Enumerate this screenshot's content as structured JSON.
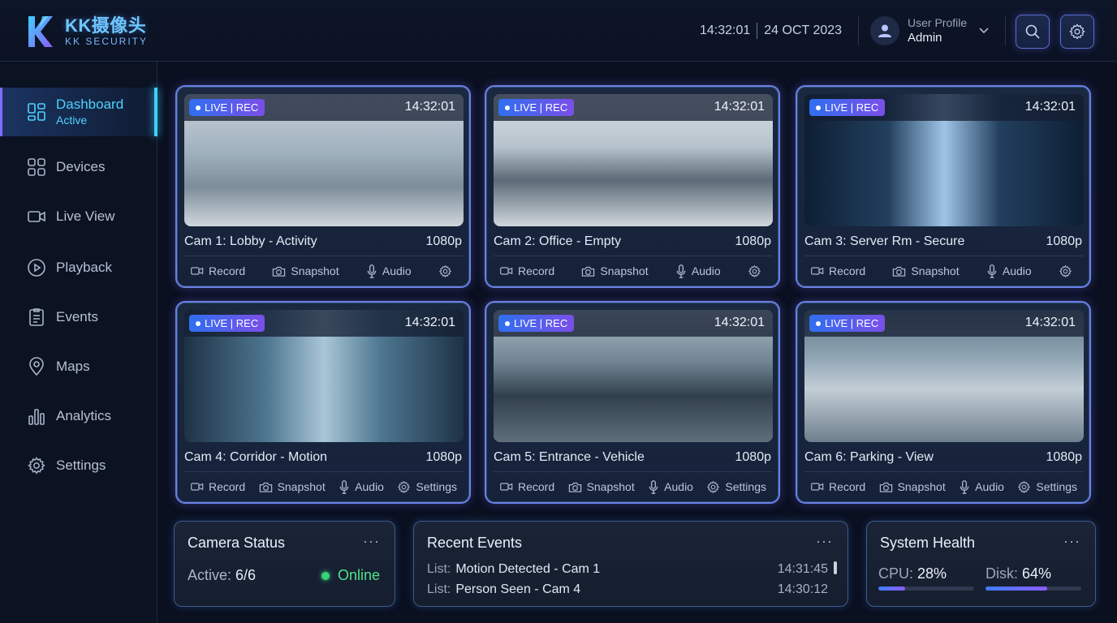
{
  "brand": {
    "title": "KK摄像头",
    "subtitle": "KK SECURITY"
  },
  "header": {
    "time": "14:32:01",
    "date": "24 OCT 2023",
    "profile_label": "User Profile",
    "profile_name": "Admin"
  },
  "sidebar": {
    "items": [
      {
        "label": "Dashboard",
        "sub": "Active",
        "icon": "dashboard-icon"
      },
      {
        "label": "Devices",
        "icon": "grid-icon"
      },
      {
        "label": "Live View",
        "icon": "video-camera-icon"
      },
      {
        "label": "Playback",
        "icon": "play-circle-icon"
      },
      {
        "label": "Events",
        "icon": "clipboard-list-icon"
      },
      {
        "label": "Maps",
        "icon": "map-pin-icon"
      },
      {
        "label": "Analytics",
        "icon": "bar-chart-icon"
      },
      {
        "label": "Settings",
        "icon": "gear-icon"
      }
    ]
  },
  "cameras": [
    {
      "badge": "LIVE | REC",
      "time": "14:32:01",
      "name": "Cam 1: Lobby - Activity",
      "res": "1080p",
      "actions": [
        "Record",
        "Snapshot",
        "Audio"
      ]
    },
    {
      "badge": "LIVE | REC",
      "time": "14:32:01",
      "name": "Cam 2: Office - Empty",
      "res": "1080p",
      "actions": [
        "Record",
        "Snapshot",
        "Audio"
      ]
    },
    {
      "badge": "LIVE | REC",
      "time": "14:32:01",
      "name": "Cam 3: Server Rm - Secure",
      "res": "1080p",
      "actions": [
        "Record",
        "Snapshot",
        "Audio"
      ]
    },
    {
      "badge": "LIVE | REC",
      "time": "14:32:01",
      "name": "Cam 4: Corridor - Motion",
      "res": "1080p",
      "actions": [
        "Record",
        "Snapshot",
        "Audio",
        "Settings"
      ]
    },
    {
      "badge": "LIVE | REC",
      "time": "14:32:01",
      "name": "Cam 5: Entrance - Vehicle",
      "res": "1080p",
      "actions": [
        "Record",
        "Snapshot",
        "Audio",
        "Settings"
      ]
    },
    {
      "badge": "LIVE | REC",
      "time": "14:32:01",
      "name": "Cam 6: Parking - View",
      "res": "1080p",
      "actions": [
        "Record",
        "Snapshot",
        "Audio",
        "Settings"
      ]
    }
  ],
  "camera_status": {
    "title": "Camera Status",
    "more": "···",
    "active_label": "Active:",
    "active_value": "6/6",
    "online": "Online"
  },
  "recent_events": {
    "title": "Recent Events",
    "more": "···",
    "rows": [
      {
        "prefix": "List:",
        "text": "Motion Detected - Cam 1",
        "time": "14:31:45"
      },
      {
        "prefix": "List:",
        "text": "Person Seen - Cam 4",
        "time": "14:30:12"
      }
    ]
  },
  "system_health": {
    "title": "System Health",
    "more": "···",
    "cpu_label": "CPU:",
    "cpu_value": "28%",
    "cpu_fraction": 0.28,
    "disk_label": "Disk:",
    "disk_value": "64%",
    "disk_fraction": 0.64
  },
  "colors": {
    "accent_cyan": "#3fd0ff",
    "accent_purple": "#7f6bff",
    "online_green": "#35d27a",
    "background": "#0a1020"
  }
}
